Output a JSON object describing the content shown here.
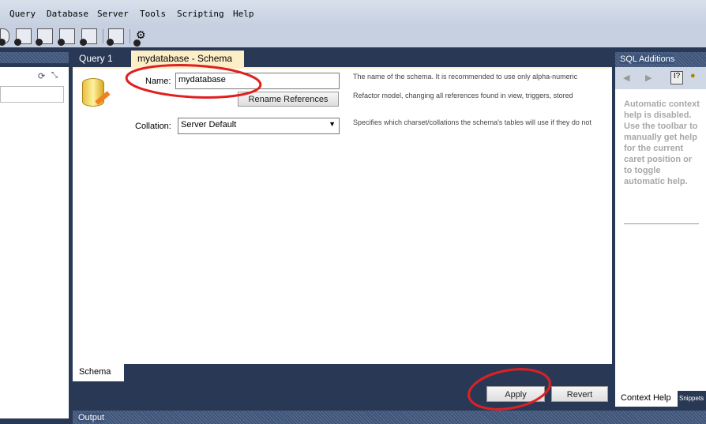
{
  "menu": [
    "Query",
    "Database",
    "Server",
    "Tools",
    "Scripting",
    "Help"
  ],
  "tabs": {
    "query": "Query 1",
    "schema": "mydatabase - Schema",
    "close": "×"
  },
  "form": {
    "name_label": "Name:",
    "name_value": "mydatabase",
    "rename_button": "Rename References",
    "collation_label": "Collation:",
    "collation_value": "Server Default",
    "hints": [
      "The name of the schema. It is recommended to use only alpha-numeric",
      "Refactor model, changing all references found in view, triggers, stored",
      "Specifies which charset/collations the schema's tables will use if they do not"
    ]
  },
  "bottom_tab": "Schema",
  "buttons": {
    "apply": "Apply",
    "revert": "Revert"
  },
  "right": {
    "title": "SQL Additions",
    "help_text": "Automatic context help is disabled. Use the toolbar to manually get help for the current caret position or to toggle automatic help.",
    "tabs": [
      "Context Help",
      "Snippets"
    ]
  },
  "output": "Output",
  "colors": {
    "annotation": "#e02020",
    "navy": "#293955",
    "tab_active": "#fcefc8"
  }
}
